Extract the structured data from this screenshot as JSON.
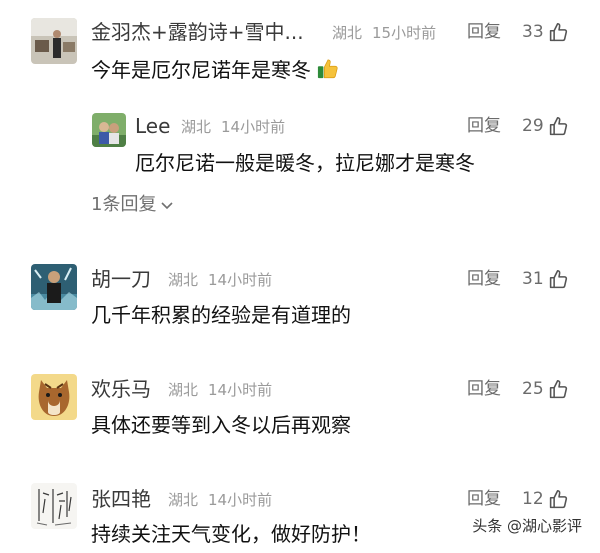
{
  "comments": [
    {
      "name": "金羽杰+露韵诗+雪中...",
      "location": "湖北",
      "time": "15小时前",
      "reply_label": "回复",
      "likes": "33",
      "text": "今年是厄尔尼诺年是寒冬",
      "emoji": "thumbs-up",
      "replies": [
        {
          "name": "Lee",
          "location": "湖北",
          "time": "14小时前",
          "reply_label": "回复",
          "likes": "29",
          "text": "厄尔尼诺一般是暖冬，拉尼娜才是寒冬"
        }
      ],
      "more_replies": "1条回复"
    },
    {
      "name": "胡一刀",
      "location": "湖北",
      "time": "14小时前",
      "reply_label": "回复",
      "likes": "31",
      "text": "几千年积累的经验是有道理的"
    },
    {
      "name": "欢乐马",
      "location": "湖北",
      "time": "14小时前",
      "reply_label": "回复",
      "likes": "25",
      "text": "具体还要等到入冬以后再观察"
    },
    {
      "name": "张四艳",
      "location": "湖北",
      "time": "14小时前",
      "reply_label": "回复",
      "likes": "12",
      "text": "持续关注天气变化，做好防护！"
    }
  ],
  "watermark": "头条 @湖心影评"
}
